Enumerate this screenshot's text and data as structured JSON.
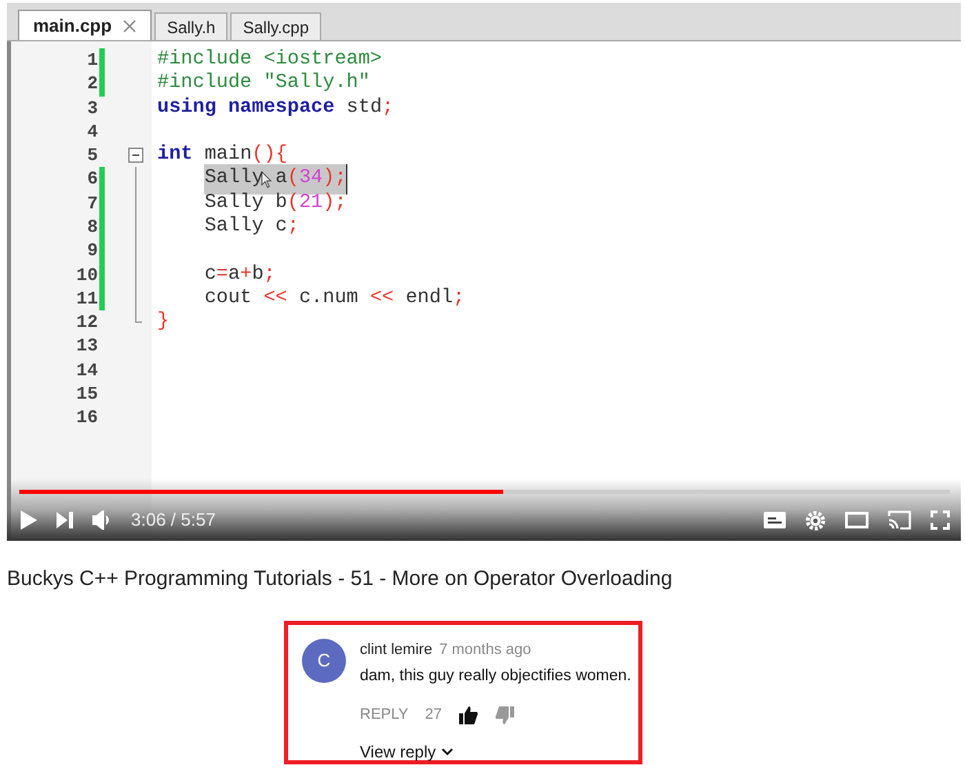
{
  "editor": {
    "tabs": [
      {
        "label": "main.cpp",
        "selected": true,
        "closable": true
      },
      {
        "label": "Sally.h",
        "selected": false,
        "closable": false
      },
      {
        "label": "Sally.cpp",
        "selected": false,
        "closable": false
      }
    ],
    "lines": [
      {
        "number": "1",
        "changed": true,
        "kind": "plain",
        "tokens": [
          {
            "kind": "pre",
            "text": "#include <iostream>"
          }
        ]
      },
      {
        "number": "2",
        "changed": true,
        "kind": "plain",
        "tokens": [
          {
            "kind": "pre",
            "text": "#include \"Sally.h\""
          }
        ]
      },
      {
        "number": "3",
        "changed": false,
        "kind": "plain",
        "tokens": [
          {
            "kind": "kw",
            "text": "using namespace"
          },
          {
            "kind": "plain",
            "text": " std"
          },
          {
            "kind": "op",
            "text": ";"
          }
        ]
      },
      {
        "number": "4",
        "changed": false,
        "kind": "plain"
      },
      {
        "number": "5",
        "changed": false,
        "kind": "foldstart",
        "tokens": [
          {
            "kind": "kw",
            "text": "int"
          },
          {
            "kind": "plain",
            "text": " main"
          },
          {
            "kind": "op",
            "text": "(){"
          }
        ]
      },
      {
        "number": "6",
        "changed": true,
        "kind": "foldbody",
        "selected": true,
        "tokens": [
          {
            "kind": "plain",
            "text": "    Sally a"
          },
          {
            "kind": "op",
            "text": "("
          },
          {
            "kind": "num",
            "text": "34"
          },
          {
            "kind": "op",
            "text": ");"
          }
        ]
      },
      {
        "number": "7",
        "changed": true,
        "kind": "foldbody",
        "selected": false,
        "tokens": [
          {
            "kind": "plain",
            "text": "    Sally b"
          },
          {
            "kind": "op",
            "text": "("
          },
          {
            "kind": "num",
            "text": "21"
          },
          {
            "kind": "op",
            "text": ");"
          }
        ]
      },
      {
        "number": "8",
        "changed": true,
        "kind": "foldbody",
        "tokens": [
          {
            "kind": "plain",
            "text": "    Sally c"
          },
          {
            "kind": "op",
            "text": ";"
          }
        ]
      },
      {
        "number": "9",
        "changed": true,
        "kind": "foldbody"
      },
      {
        "number": "10",
        "changed": true,
        "kind": "foldbody",
        "tokens": [
          {
            "kind": "plain",
            "text": "    c"
          },
          {
            "kind": "op",
            "text": "="
          },
          {
            "kind": "plain",
            "text": "a"
          },
          {
            "kind": "op",
            "text": "+"
          },
          {
            "kind": "plain",
            "text": "b"
          },
          {
            "kind": "op",
            "text": ";"
          }
        ]
      },
      {
        "number": "11",
        "changed": true,
        "kind": "foldbody",
        "tokens": [
          {
            "kind": "plain",
            "text": "    cout "
          },
          {
            "kind": "op",
            "text": "<<"
          },
          {
            "kind": "plain",
            "text": " c.num "
          },
          {
            "kind": "op",
            "text": "<<"
          },
          {
            "kind": "plain",
            "text": " endl"
          },
          {
            "kind": "op",
            "text": ";"
          }
        ]
      },
      {
        "number": "12",
        "changed": false,
        "kind": "foldend",
        "tokens": [
          {
            "kind": "op",
            "text": "}"
          }
        ]
      },
      {
        "number": "13",
        "changed": false,
        "kind": "plain"
      },
      {
        "number": "14",
        "changed": false,
        "kind": "plain"
      },
      {
        "number": "15",
        "changed": false,
        "kind": "plain"
      },
      {
        "number": "16",
        "changed": false,
        "kind": "plain"
      }
    ]
  },
  "player": {
    "progress": {
      "level": 0.52
    },
    "time": "3:06 / 5:57"
  },
  "video_title": "Buckys C++ Programming Tutorials - 51 - More on Operator Overloading",
  "comment": {
    "avatar": "C",
    "author": "clint lemire",
    "time": "7 months ago",
    "text": "dam, this guy really objectifies women.",
    "reply": "REPLY",
    "likes": "27",
    "view_replies": "View reply"
  }
}
